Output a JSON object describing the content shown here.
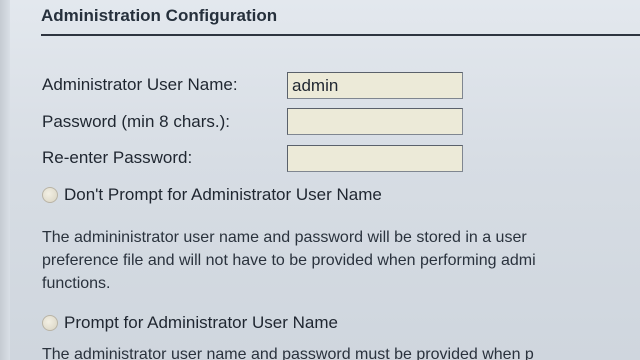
{
  "section": {
    "title": "Administration Configuration"
  },
  "fields": {
    "username_label": "Administrator User Name:",
    "username_value": "admin",
    "password_label": "Password (min 8 chars.):",
    "password_value": "",
    "reenter_label": "Re-enter Password:",
    "reenter_value": ""
  },
  "options": {
    "dont_prompt_label": "Don't Prompt for Administrator User Name",
    "dont_prompt_desc": [
      "The admininistrator user name and password will be stored in a user",
      "preference file and will not have to be provided when performing admi",
      "functions."
    ],
    "prompt_label": "Prompt for Administrator User Name",
    "prompt_desc_partial": "The administrator user name and password must be provided when p"
  }
}
